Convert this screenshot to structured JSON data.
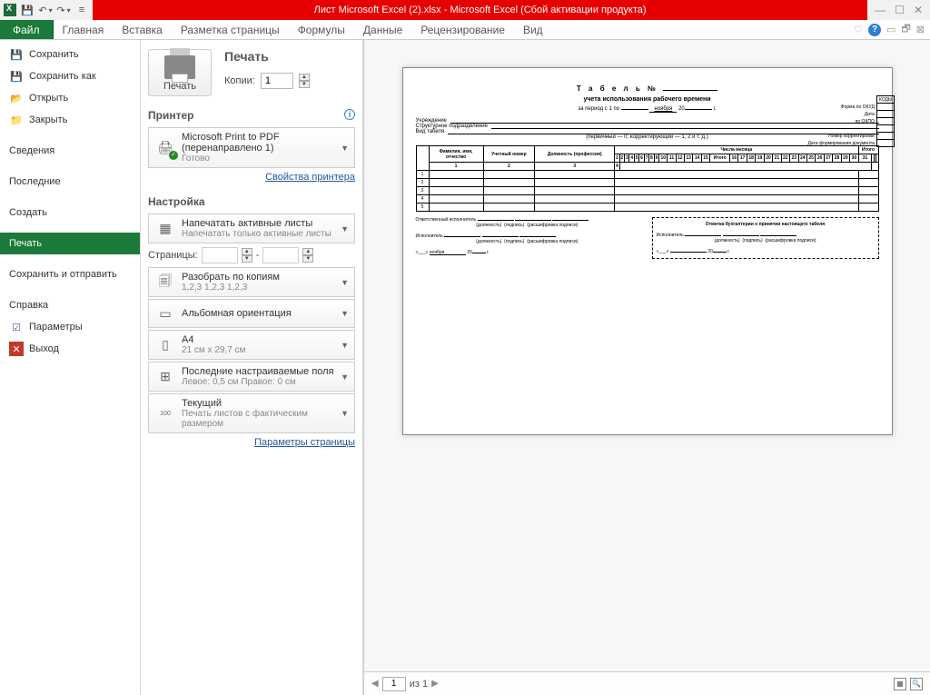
{
  "titlebar": {
    "title": "Лист Microsoft Excel (2).xlsx - Microsoft Excel (Сбой активации продукта)"
  },
  "ribbon": {
    "file": "Файл",
    "tabs": [
      "Главная",
      "Вставка",
      "Разметка страницы",
      "Формулы",
      "Данные",
      "Рецензирование",
      "Вид"
    ]
  },
  "sidebar": {
    "items": [
      {
        "label": "Сохранить"
      },
      {
        "label": "Сохранить как"
      },
      {
        "label": "Открыть"
      },
      {
        "label": "Закрыть"
      },
      {
        "label": "Сведения"
      },
      {
        "label": "Последние"
      },
      {
        "label": "Создать"
      },
      {
        "label": "Печать"
      },
      {
        "label": "Сохранить и отправить"
      },
      {
        "label": "Справка"
      },
      {
        "label": "Параметры"
      },
      {
        "label": "Выход"
      }
    ]
  },
  "print": {
    "title": "Печать",
    "button": "Печать",
    "copies_label": "Копии:",
    "copies_value": "1",
    "printer_section": "Принтер",
    "printer_name": "Microsoft Print to PDF (перенаправлено 1)",
    "printer_status": "Готово",
    "printer_props": "Свойства принтера",
    "settings_section": "Настройка",
    "active_sheets_title": "Напечатать активные листы",
    "active_sheets_sub": "Напечатать только активные листы",
    "pages_label": "Страницы:",
    "dash": "-",
    "collate_title": "Разобрать по копиям",
    "collate_sub": "1,2,3   1,2,3   1,2,3",
    "orientation": "Альбомная ориентация",
    "paper_title": "A4",
    "paper_sub": "21 см x 29,7 см",
    "margins_title": "Последние настраиваемые поля",
    "margins_sub": "Левое: 0,5 см   Правое: 0 см",
    "scale_title": "Текущий",
    "scale_sub": "Печать листов с фактическим размером",
    "page_setup": "Параметры страницы"
  },
  "page": {
    "tabel": "Т а б е л ь №",
    "subtitle": "учета использования рабочего времени",
    "period_prefix": "за период с 1 по",
    "month": "ноября",
    "year_prefix": "20",
    "year_suffix": "г.",
    "codes_header": "КОДЫ",
    "form_okud": "Форма по ОКУД",
    "date": "Дата",
    "okpo": "по ОКПО",
    "inst": "Учреждение",
    "dept": "Структурное подразделение",
    "type": "Вид табеля",
    "type_note": "(первичный — 0; корректирующий — 1, 2 и т. д.)",
    "corr_num": "Номер корректировки",
    "doc_date": "Дата формирования документа",
    "col_fio": "Фамилия, имя, отчество",
    "col_num": "Учетный номер",
    "col_pos": "Должность (профессия)",
    "col_days": "Числа месяца",
    "col_total": "Итого",
    "resp": "Ответственный исполнитель",
    "sign_pos": "(должность)",
    "sign_sign": "(подпись)",
    "sign_name": "(расшифровка подписи)",
    "exec": "Исполнитель",
    "mark": "Отметка бухгалтерии о принятии настоящего табеля",
    "mark_exec": "Исполнитель",
    "quote": "«___»"
  },
  "status": {
    "page_current": "1",
    "page_of": "из 1"
  }
}
